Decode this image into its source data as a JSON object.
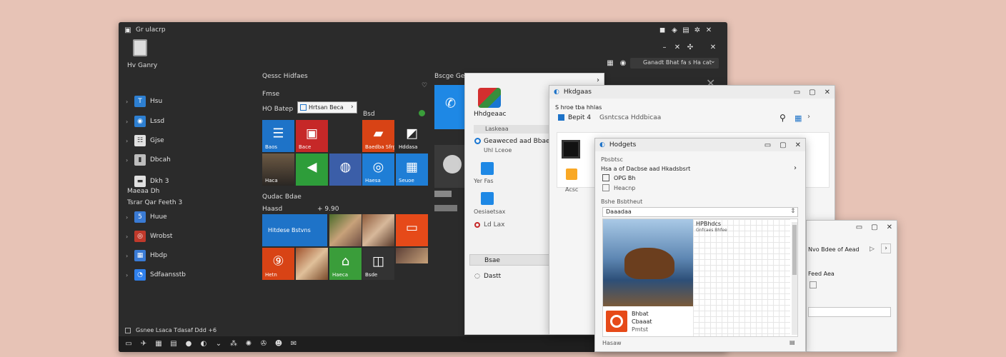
{
  "desktop": {
    "title": "Gr ulacrp",
    "top_controls": [
      "–",
      "✕",
      "✣",
      "✕"
    ],
    "user_label": "Hv Ganry",
    "search_text": "Ganadt Bhat fa s Ha cat",
    "sidebar": [
      {
        "label": "Hsu",
        "color": "#2d7fd1",
        "glyph": "T"
      },
      {
        "label": "Lssd",
        "color": "#2d7fd1",
        "glyph": "◉"
      },
      {
        "label": "Gjse",
        "color": "#dddddd",
        "glyph": "☷"
      },
      {
        "label": "Dbcah",
        "color": "#bdbdbd",
        "glyph": "▮"
      },
      {
        "label": "Dkh 3",
        "color": "#e0e0e0",
        "glyph": "▬"
      }
    ],
    "mid_label_a": "Maeaa Dh",
    "mid_label_b": "Tsrar Qar Feeth 3",
    "sidebar_b": [
      {
        "label": "Huue",
        "color": "#3a7bd5",
        "glyph": "5"
      },
      {
        "label": "Wrobst",
        "color": "#c0392b",
        "glyph": "◎"
      },
      {
        "label": "Hbdp",
        "color": "#3a7bd5",
        "glyph": "▦"
      },
      {
        "label": "Sdfaansstb",
        "color": "#2f80ed",
        "glyph": "◔"
      }
    ],
    "section1_title": "Qessc Hidfaes",
    "group1": "Fmse",
    "group1b": "HO Batep",
    "tooltip": "Hrtsan Beca",
    "tooltip_arrow": "›",
    "group1c": "Bsd",
    "section2_title": "Qudac Bdae",
    "group2": "Haasd",
    "group2b": "+ 9.90",
    "big_tile": "Hitdese Bstvns",
    "right_header": "Bscge Ge",
    "footer_text": "Gsnee Lsaca Tdasaf Ddd +6",
    "tiles": [
      {
        "label": "Baos",
        "color": "#1e73c8",
        "glyph": "☰"
      },
      {
        "label": "Bace",
        "color": "#c62828",
        "glyph": "▣"
      },
      {
        "label": "Baedba Sfrg",
        "color": "#d84315",
        "glyph": "▰"
      },
      {
        "label": "Hddasa",
        "color": "#2b2b2b",
        "glyph": "◩"
      },
      {
        "label": "",
        "color": "#1e88e5",
        "glyph": "✆"
      },
      {
        "label": "Haca",
        "color": "#4a4a4a",
        "glyph": ""
      },
      {
        "label": "",
        "color": "#2e9d3a",
        "glyph": "◀"
      },
      {
        "label": "",
        "color": "#3b5ea8",
        "glyph": "◍"
      },
      {
        "label": "Haesa",
        "color": "#1f7ed6",
        "glyph": "◎"
      },
      {
        "label": "Seuoe",
        "color": "#1f7ed6",
        "glyph": "▦"
      },
      {
        "label": "",
        "color": "#6d4c41",
        "glyph": ""
      },
      {
        "label": "",
        "color": "#8e5a3a",
        "glyph": ""
      },
      {
        "label": "",
        "color": "#e64a19",
        "glyph": "▭"
      },
      {
        "label": "Hetn",
        "color": "#d84315",
        "glyph": "⑨"
      },
      {
        "label": "",
        "color": "#a0522d",
        "glyph": ""
      },
      {
        "label": "Haeca",
        "color": "#3a9d3a",
        "glyph": "⌂"
      },
      {
        "label": "Bsde",
        "color": "#333333",
        "glyph": "◫"
      },
      {
        "label": "",
        "color": "#5d4037",
        "glyph": ""
      }
    ],
    "taskbar_icons": [
      "▭",
      "✈",
      "▦",
      "▤",
      "●",
      "◐",
      "⌄",
      "⁂",
      "✺",
      "✇",
      "☻",
      "✉"
    ]
  },
  "panel1": {
    "app_name": "Hhdgeaac",
    "items": [
      "Laskeaa",
      "Geaweced aad Bbae",
      "Uhl Lceoe",
      "Yer Fas",
      "Oesiaetsax",
      "Ld Lax",
      "Bsae",
      "Dastt"
    ],
    "chevron": "›"
  },
  "win1": {
    "title": "Hkdgaas",
    "subtitle": "S hroe tba hhlas",
    "path_a": "Bepit 4",
    "path_b": "Gsntcsca Hddbicaa",
    "tile_label": "Acsc"
  },
  "win2": {
    "title": "Hodgets",
    "label_a": "Pbsbtsc",
    "row1": "Hsa a of Dacbse aad Hkadsbsrt",
    "row2": "OPG Bh",
    "row3": "Heacnp",
    "label_b": "Bshe Bsbtheut",
    "dropdown": "Daaadaa",
    "img_caption_1": "Bhbat",
    "img_caption_2": "Cbaaat",
    "img_caption_3": "Pmtst",
    "grid_header_1": "HPBhdcs",
    "grid_header_2": "Gnfcaes Bhfee",
    "footer": "Hasaw"
  },
  "win3": {
    "row1": "Nvo Bdee of Aead",
    "row2": "Feed Aea",
    "arrow": "›"
  }
}
